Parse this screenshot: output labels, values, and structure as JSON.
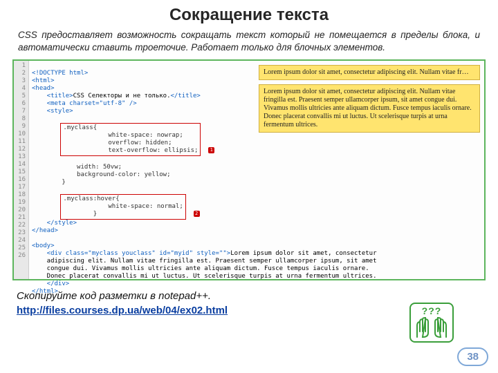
{
  "title": "Сокращение текста",
  "intro": "CSS предоставляет возможность сокращать текст который не помещается в пределы блока, и автоматически ставить троеточие. Работает только для блочных элементов.",
  "gutter_lines": [
    "1",
    "2",
    "3",
    "4",
    "5",
    "6",
    "7",
    "8",
    "9",
    "10",
    "11",
    "12",
    "13",
    "14",
    "15",
    "16",
    "17",
    "18",
    "19",
    "20",
    "21",
    "22",
    "23",
    "24",
    "25",
    "26",
    ""
  ],
  "code": {
    "l1": "<!DOCTYPE html>",
    "l2": "<html>",
    "l3": "<head>",
    "l4_open": "    <title>",
    "l4_text": "CSS Селекторы и не только.",
    "l4_close": "</title>",
    "l5": "    <meta charset=\"utf-8\" />",
    "l6": "    <style>",
    "rule1_sel": ".myclass{",
    "rule1_p1": "white-space: nowrap;",
    "rule1_p2": "overflow: hidden;",
    "rule1_p3": "text-overflow: ellipsis;",
    "rule1_close": "}",
    "badge1": "1",
    "extra1": "width: 50vw;",
    "extra2": "background-color: yellow;",
    "rule2_sel": ".myclass:hover{",
    "rule2_p1": "white-space: normal;",
    "rule2_close": "}",
    "badge2": "2",
    "l20": "    </style>",
    "l21": "</head>",
    "l23": "<body>",
    "div_open": "    <div class=\"myclass youclass\" id=\"myid\" style=\"\">",
    "div_text": "Lorem ipsum dolor sit amet, consectetur\n    adipiscing elit. Nullam vitae fringilla est. Praesent semper ullamcorper ipsum, sit amet\n    congue dui. Vivamus mollis ultricies ante aliquam dictum. Fusce tempus iaculis ornare.\n    Donec placerat convallis mi ut luctus. Ut scelerisque turpis at urna fermentum ultrices.",
    "div_close": "    </div>",
    "l26": "</html>"
  },
  "preview": {
    "trunc": "Lorem ipsum dolor sit amet, consectetur adipiscing elit. Nullam vitae fr…",
    "full": "Lorem ipsum dolor sit amet, consectetur adipiscing elit. Nullam vitae fringilla est. Praesent semper ullamcorper ipsum, sit amet congue dui. Vivamus mollis ultricies ante aliquam dictum. Fusce tempus iaculis ornare. Donec placerat convallis mi ut luctus. Ut scelerisque turpis at urna fermentum ultrices."
  },
  "instruction": "Скопируйте код  разметки в notepad++.",
  "link_text": "http://files.courses.dp.ua/web/04/ex02.html",
  "page_number": "38",
  "hands_q": "???"
}
